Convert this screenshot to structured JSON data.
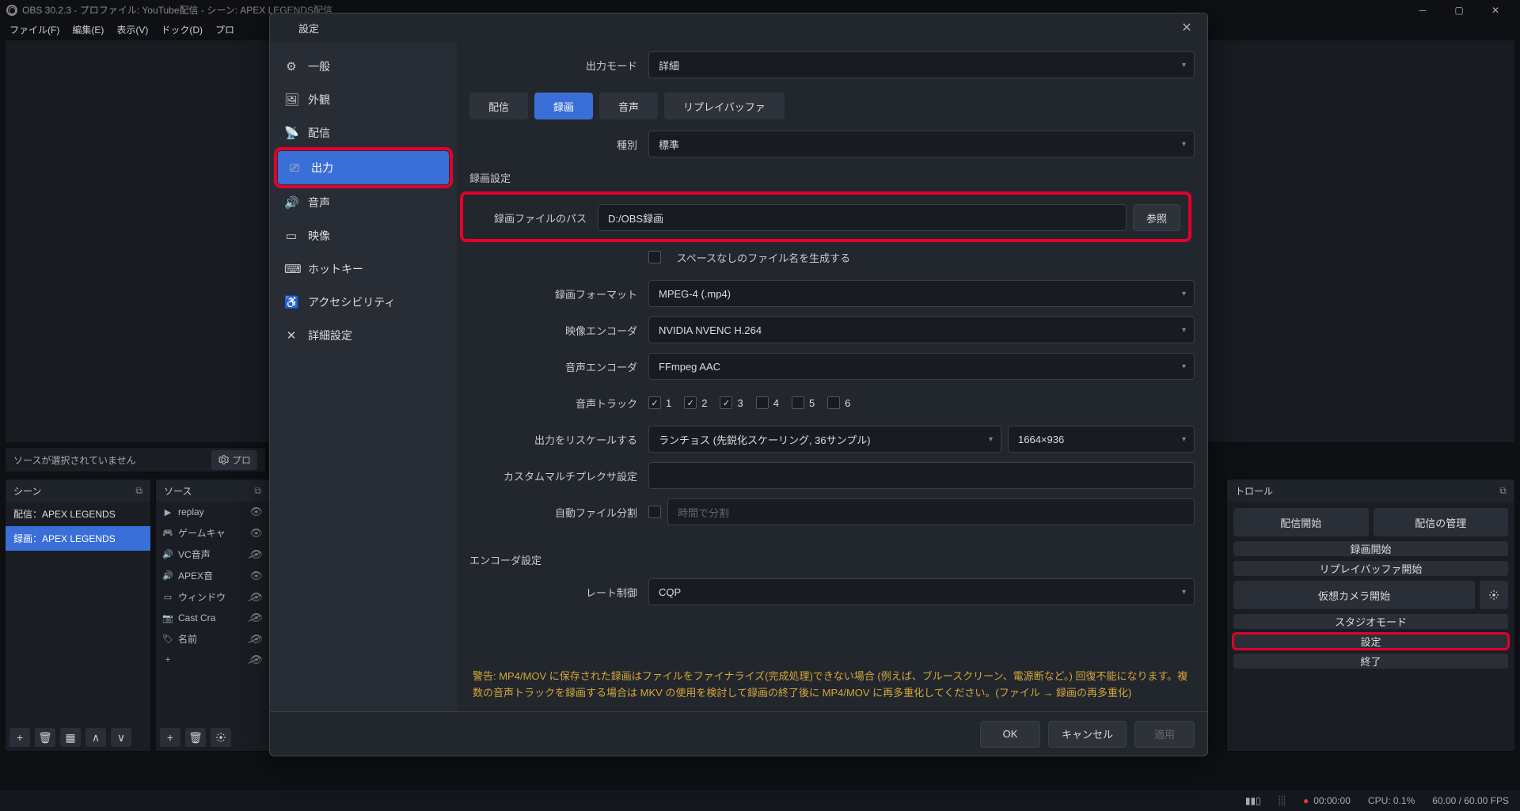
{
  "window": {
    "title": "OBS 30.2.3 - プロファイル: YouTube配信 - シーン: APEX LEGENDS配信"
  },
  "menu": [
    "ファイル(F)",
    "編集(E)",
    "表示(V)",
    "ドック(D)",
    "プロ"
  ],
  "props_bar": {
    "text": "ソースが選択されていません",
    "button": "プロ"
  },
  "scenes": {
    "title": "シーン",
    "items": [
      "配信：APEX LEGENDS",
      "録画：APEX LEGENDS"
    ]
  },
  "sources": {
    "title": "ソース",
    "items": [
      {
        "icon": "▶",
        "label": "replay",
        "hidden": false
      },
      {
        "icon": "🎮",
        "label": "ゲームキャ",
        "hidden": false
      },
      {
        "icon": "🔊",
        "label": "VC音声",
        "hidden": true
      },
      {
        "icon": "🔊",
        "label": "APEX音",
        "hidden": false
      },
      {
        "icon": "▭",
        "label": "ウィンドウ",
        "hidden": true
      },
      {
        "icon": "📷",
        "label": "Cast Cra",
        "hidden": true
      },
      {
        "icon": "🏷",
        "label": "名前",
        "hidden": true
      },
      {
        "icon": "+",
        "label": "",
        "hidden": true
      }
    ]
  },
  "controls": {
    "title": "トロール",
    "buttons": {
      "stream_start": "配信開始",
      "stream_manage": "配信の管理",
      "rec_start": "録画開始",
      "replay_start": "リプレイバッファ開始",
      "vcam_start": "仮想カメラ開始",
      "studio": "スタジオモード",
      "settings": "設定",
      "exit": "終了"
    }
  },
  "status": {
    "rec": "00:00:00",
    "cpu": "CPU: 0.1%",
    "fps": "60.00 / 60.00 FPS"
  },
  "dialog": {
    "title": "設定",
    "sidebar": [
      {
        "icon": "⚙",
        "label": "一般"
      },
      {
        "icon": "🖼",
        "label": "外観"
      },
      {
        "icon": "📡",
        "label": "配信"
      },
      {
        "icon": "⎚",
        "label": "出力",
        "selected": true,
        "highlight": true
      },
      {
        "icon": "🔊",
        "label": "音声"
      },
      {
        "icon": "▭",
        "label": "映像"
      },
      {
        "icon": "⌨",
        "label": "ホットキー"
      },
      {
        "icon": "♿",
        "label": "アクセシビリティ"
      },
      {
        "icon": "✕",
        "label": "詳細設定"
      }
    ],
    "output_mode": {
      "label": "出力モード",
      "value": "詳細"
    },
    "tabs": [
      "配信",
      "録画",
      "音声",
      "リプレイバッファ"
    ],
    "active_tab": 1,
    "type": {
      "label": "種別",
      "value": "標準"
    },
    "rec_settings": {
      "title": "録画設定",
      "path": {
        "label": "録画ファイルのパス",
        "value": "D:/OBS録画",
        "browse": "参照"
      },
      "nospaces": "スペースなしのファイル名を生成する",
      "format": {
        "label": "録画フォーマット",
        "value": "MPEG-4 (.mp4)"
      },
      "venc": {
        "label": "映像エンコーダ",
        "value": "NVIDIA NVENC H.264"
      },
      "aenc": {
        "label": "音声エンコーダ",
        "value": "FFmpeg AAC"
      },
      "tracks": {
        "label": "音声トラック",
        "checked": [
          true,
          true,
          true,
          false,
          false,
          false
        ]
      },
      "rescale": {
        "label": "出力をリスケールする",
        "method": "ランチョス (先鋭化スケーリング, 36サンプル)",
        "res": "1664×936"
      },
      "mux": {
        "label": "カスタムマルチプレクサ設定",
        "value": ""
      },
      "auto_split": {
        "label": "自動ファイル分割",
        "value": "時間で分割"
      }
    },
    "enc_settings": {
      "title": "エンコーダ設定",
      "rate": {
        "label": "レート制御",
        "value": "CQP"
      }
    },
    "warning": "警告: MP4/MOV に保存された録画はファイルをファイナライズ(完成処理)できない場合 (例えば、ブルースクリーン、電源断など。) 回復不能になります。複数の音声トラックを録画する場合は MKV の使用を検討して録画の終了後に MP4/MOV に再多重化してください。(ファイル → 録画の再多重化)",
    "buttons": {
      "ok": "OK",
      "cancel": "キャンセル",
      "apply": "適用"
    }
  }
}
